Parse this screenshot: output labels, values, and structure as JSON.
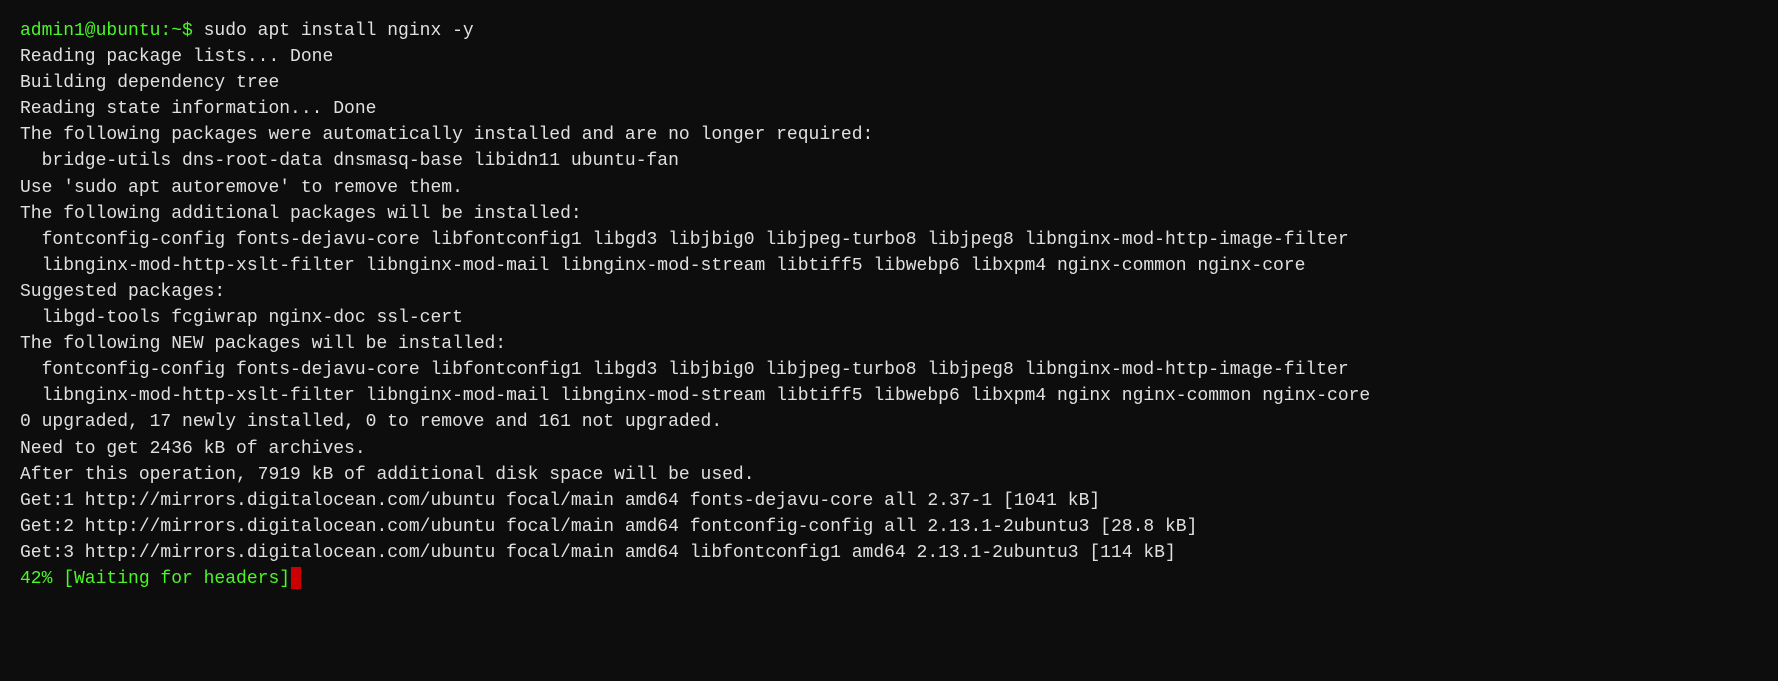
{
  "terminal": {
    "lines": [
      {
        "type": "prompt",
        "text": "admin1@ubuntu:~$ sudo apt install nginx -y"
      },
      {
        "type": "normal",
        "text": "Reading package lists... Done"
      },
      {
        "type": "normal",
        "text": "Building dependency tree"
      },
      {
        "type": "normal",
        "text": "Reading state information... Done"
      },
      {
        "type": "normal",
        "text": "The following packages were automatically installed and are no longer required:"
      },
      {
        "type": "normal",
        "text": "  bridge-utils dns-root-data dnsmasq-base libidn11 ubuntu-fan"
      },
      {
        "type": "normal",
        "text": "Use 'sudo apt autoremove' to remove them."
      },
      {
        "type": "normal",
        "text": "The following additional packages will be installed:"
      },
      {
        "type": "normal",
        "text": "  fontconfig-config fonts-dejavu-core libfontconfig1 libgd3 libjbig0 libjpeg-turbo8 libjpeg8 libnginx-mod-http-image-filter"
      },
      {
        "type": "normal",
        "text": "  libnginx-mod-http-xslt-filter libnginx-mod-mail libnginx-mod-stream libtiff5 libwebp6 libxpm4 nginx-common nginx-core"
      },
      {
        "type": "normal",
        "text": "Suggested packages:"
      },
      {
        "type": "normal",
        "text": "  libgd-tools fcgiwrap nginx-doc ssl-cert"
      },
      {
        "type": "normal",
        "text": "The following NEW packages will be installed:"
      },
      {
        "type": "normal",
        "text": "  fontconfig-config fonts-dejavu-core libfontconfig1 libgd3 libjbig0 libjpeg-turbo8 libjpeg8 libnginx-mod-http-image-filter"
      },
      {
        "type": "normal",
        "text": "  libnginx-mod-http-xslt-filter libnginx-mod-mail libnginx-mod-stream libtiff5 libwebp6 libxpm4 nginx nginx-common nginx-core"
      },
      {
        "type": "normal",
        "text": "0 upgraded, 17 newly installed, 0 to remove and 161 not upgraded."
      },
      {
        "type": "normal",
        "text": "Need to get 2436 kB of archives."
      },
      {
        "type": "normal",
        "text": "After this operation, 7919 kB of additional disk space will be used."
      },
      {
        "type": "normal",
        "text": "Get:1 http://mirrors.digitalocean.com/ubuntu focal/main amd64 fonts-dejavu-core all 2.37-1 [1041 kB]"
      },
      {
        "type": "normal",
        "text": "Get:2 http://mirrors.digitalocean.com/ubuntu focal/main amd64 fontconfig-config all 2.13.1-2ubuntu3 [28.8 kB]"
      },
      {
        "type": "normal",
        "text": "Get:3 http://mirrors.digitalocean.com/ubuntu focal/main amd64 libfontconfig1 amd64 2.13.1-2ubuntu3 [114 kB]"
      },
      {
        "type": "cursor",
        "text": "42% [Waiting for headers]"
      }
    ]
  }
}
